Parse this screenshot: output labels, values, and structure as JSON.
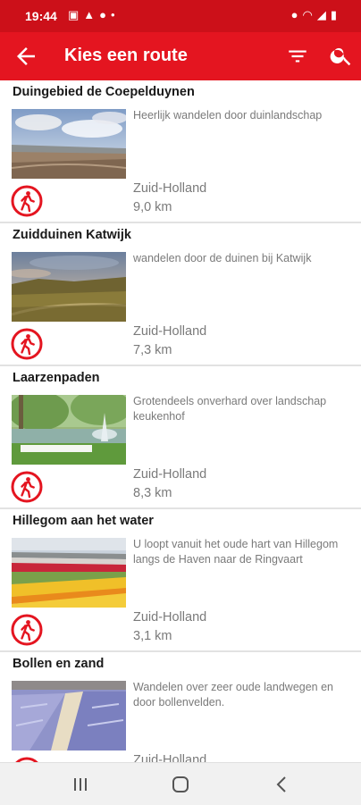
{
  "status_bar": {
    "time": "19:44",
    "left_icons": [
      "sms-icon",
      "warning-icon",
      "location-pin-icon",
      "dot-icon"
    ],
    "right_icons": [
      "location-icon",
      "wifi-icon",
      "signal-icon",
      "battery-icon"
    ]
  },
  "app_bar": {
    "title": "Kies een route",
    "back_icon": "arrow-left-icon",
    "filter_icon": "filter-icon",
    "search_icon": "search-icon",
    "color": "#e41520"
  },
  "routes": [
    {
      "name": "Duingebied de Coepelduynen",
      "description": "Heerlijk wandelen door duinlandschap",
      "region": "Zuid-Holland",
      "distance": "9,0 km",
      "icon": "walking-icon"
    },
    {
      "name": "Zuidduinen Katwijk",
      "description": "wandelen door de duinen bij Katwijk",
      "region": "Zuid-Holland",
      "distance": "7,3 km",
      "icon": "walking-icon"
    },
    {
      "name": "Laarzenpaden",
      "description": "Grotendeels onverhard over landschap keukenhof",
      "region": "Zuid-Holland",
      "distance": "8,3 km",
      "icon": "walking-icon"
    },
    {
      "name": "Hillegom aan het water",
      "description": "U loopt vanuit het oude hart van Hillegom langs de Haven naar de Ringvaart",
      "region": "Zuid-Holland",
      "distance": "3,1 km",
      "icon": "walking-icon"
    },
    {
      "name": "Bollen en zand",
      "description": "Wandelen over zeer oude landwegen en door bollenvelden.",
      "region": "Zuid-Holland",
      "distance": "",
      "icon": "walking-icon"
    }
  ],
  "nav_bar": {
    "icons": [
      "recent-apps-icon",
      "home-icon",
      "back-icon"
    ]
  }
}
